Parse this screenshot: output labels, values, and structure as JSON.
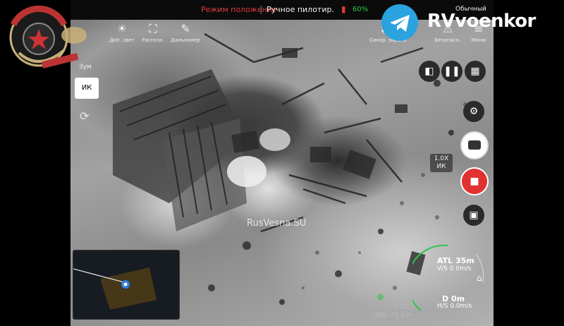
{
  "top_bar": {
    "mode": "Режим положение",
    "pilot": "Ручное пилотир.",
    "rc_signal": "60%",
    "profile": "Обычный"
  },
  "toolbar": {
    "items": [
      {
        "label": "Доп. свет",
        "icon": "light-icon"
      },
      {
        "label": "Распозн.",
        "icon": "recognition-icon"
      },
      {
        "label": "Дальномер",
        "icon": "rangefinder-icon"
      }
    ],
    "right_items": [
      {
        "label": "Синхр. экрана",
        "icon": "sync-icon"
      },
      {
        "label": "Безопасн.",
        "icon": "safety-icon"
      },
      {
        "label": "Меню",
        "icon": "menu-icon"
      }
    ]
  },
  "left_controls": {
    "zoom_label": "Зум",
    "ir_label": "ИК"
  },
  "right_controls": {
    "zoom_value": "1.0X",
    "zoom_mode": "ИК"
  },
  "telemetry": {
    "atl": "ATL 35m",
    "vs": "V/S 0.0m/s",
    "d": "D  0m",
    "hs": "H/S 0.0m/s",
    "msl": "MSL 79.0 m",
    "timer": "7:22"
  },
  "watermark": "RusVesna.SU",
  "overlay": {
    "channel": "RVvoenkor"
  },
  "colors": {
    "alert_red": "#e23b3b",
    "signal_green": "#2ec44b",
    "telegram_blue": "#2aa3df"
  }
}
